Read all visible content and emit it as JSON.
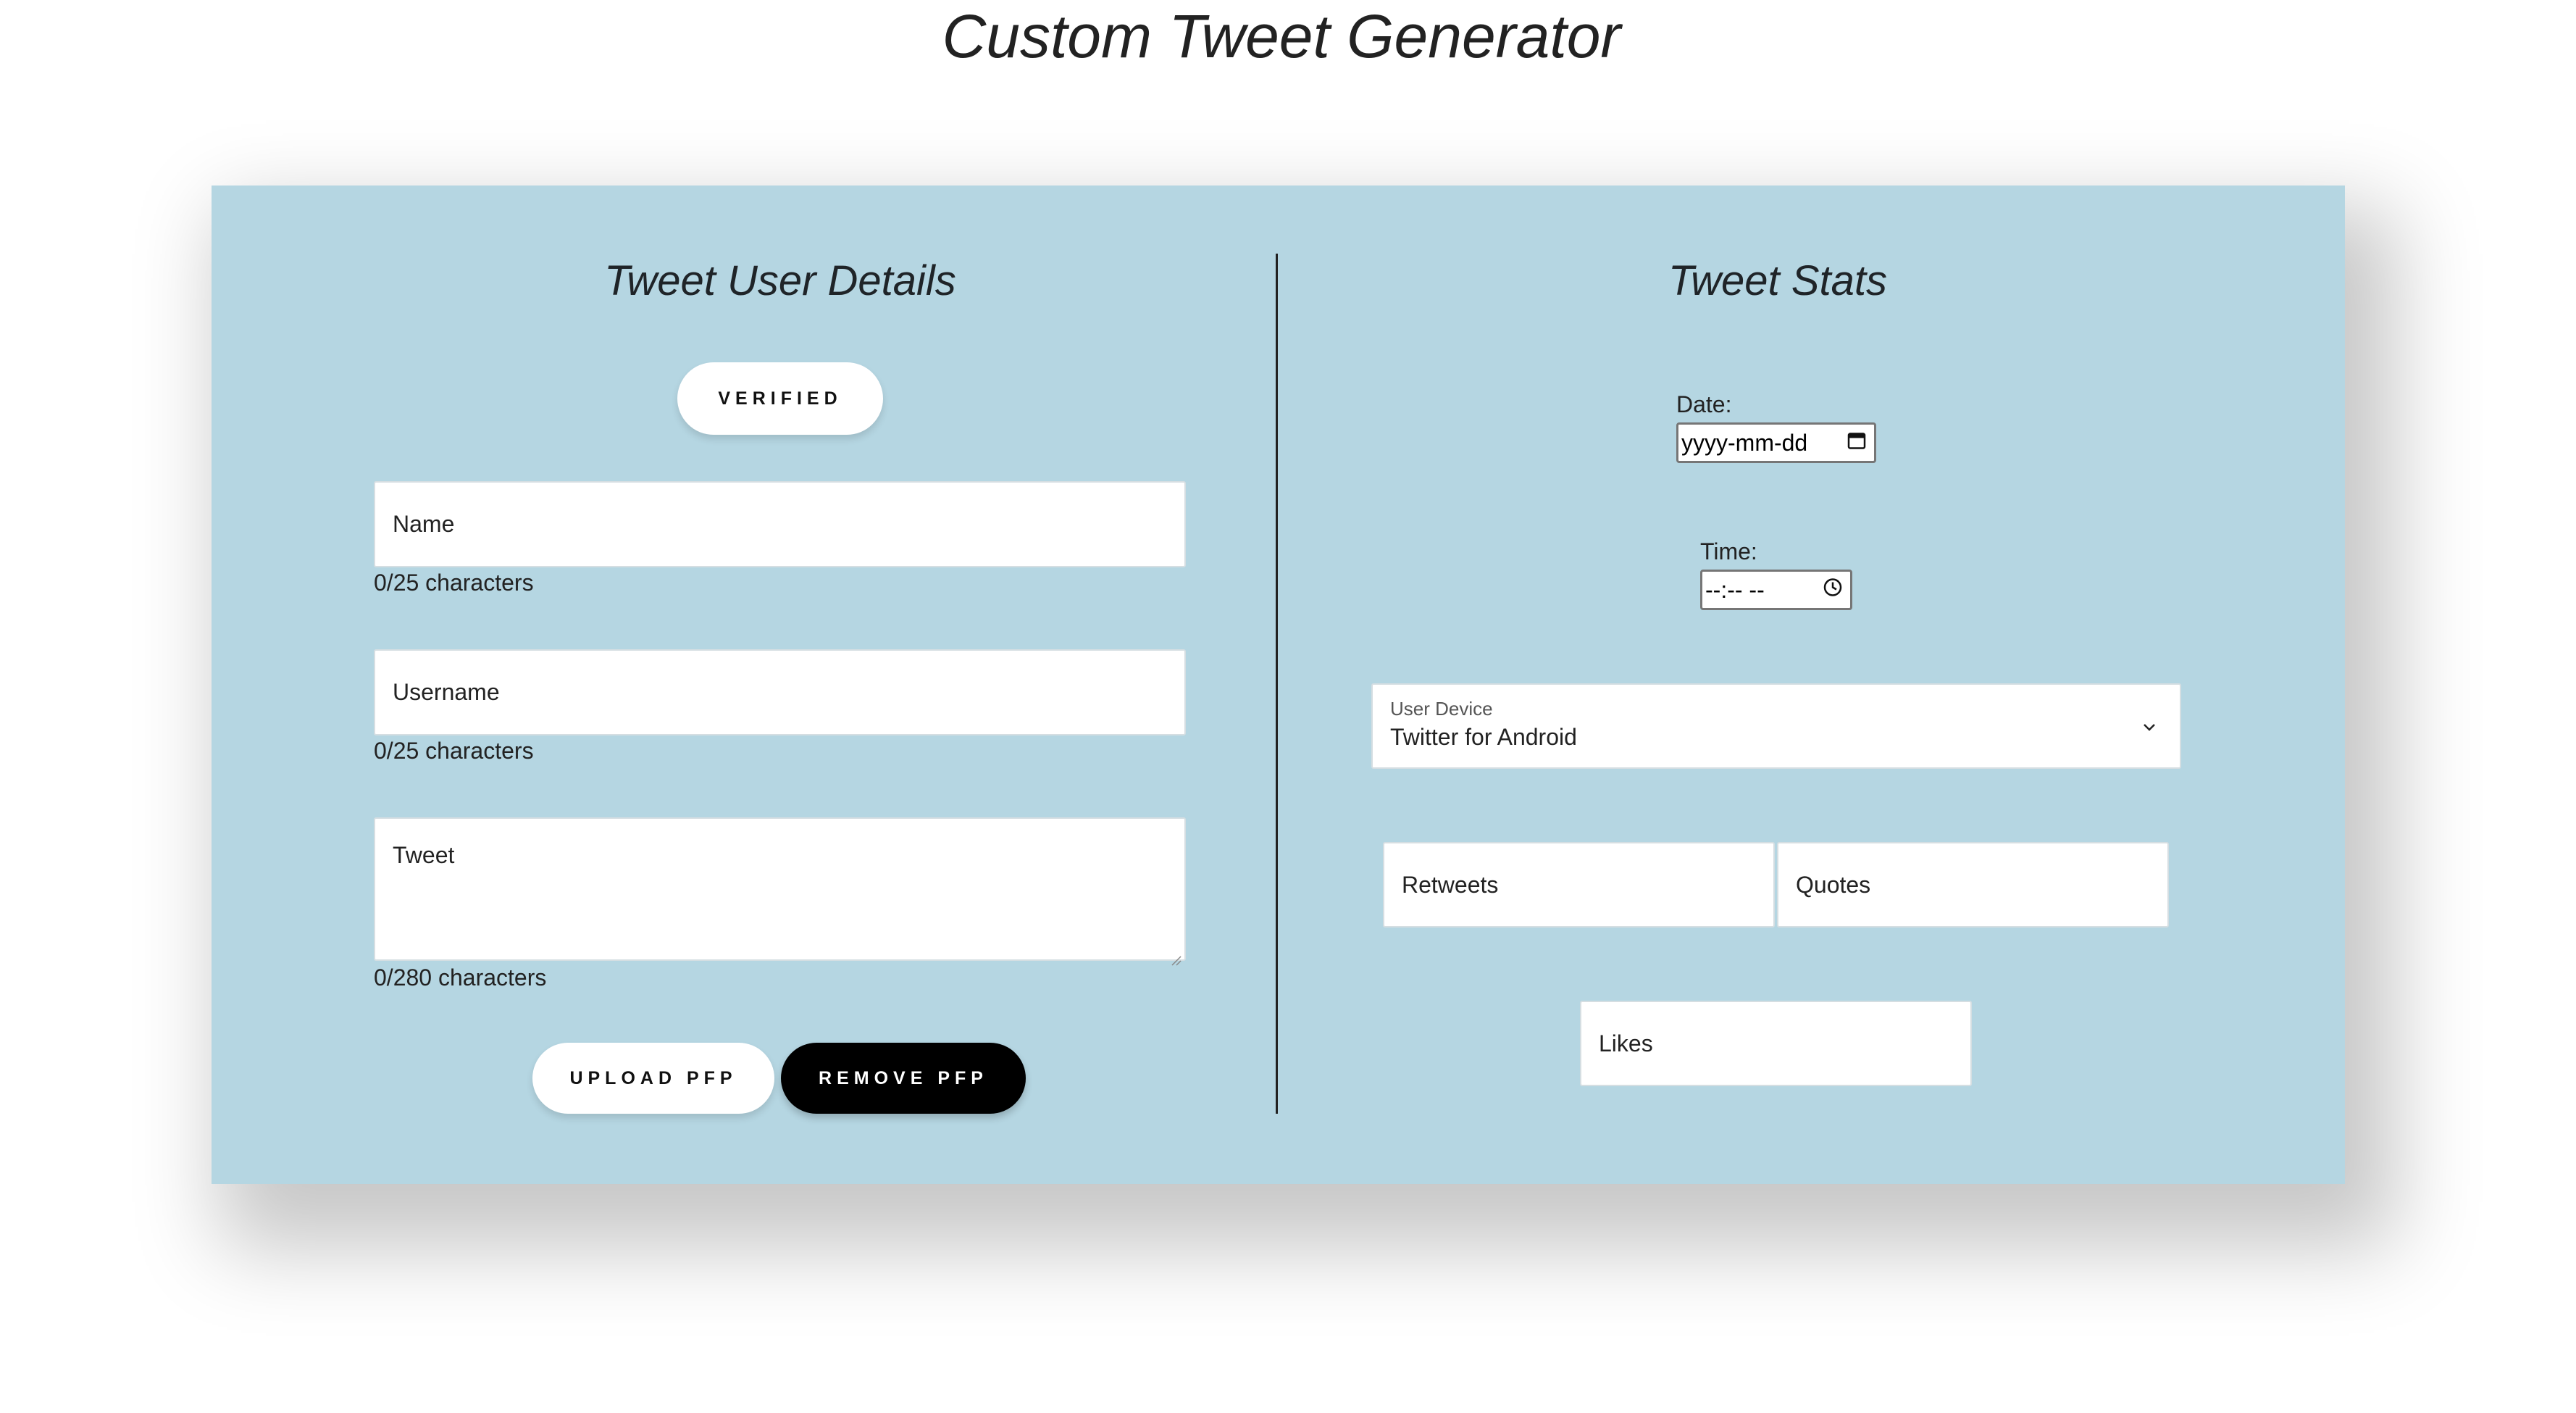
{
  "header": {
    "title": "Custom Tweet Generator"
  },
  "user_details": {
    "title": "Tweet User Details",
    "verified_label": "VERIFIED",
    "name": {
      "placeholder": "Name",
      "counter": "0/25 characters"
    },
    "username": {
      "placeholder": "Username",
      "counter": "0/25 characters"
    },
    "tweet": {
      "placeholder": "Tweet",
      "counter": "0/280 characters"
    },
    "upload_label": "UPLOAD PFP",
    "remove_label": "REMOVE PFP"
  },
  "stats": {
    "title": "Tweet Stats",
    "date_label": "Date:",
    "date_placeholder": "yyyy-mm-dd",
    "time_label": "Time:",
    "time_placeholder": "--:-- --",
    "device": {
      "label": "User Device",
      "value": "Twitter for Android"
    },
    "retweets_placeholder": "Retweets",
    "quotes_placeholder": "Quotes",
    "likes_placeholder": "Likes"
  },
  "colors": {
    "panel_background": "#b5d6e2",
    "page_background": "#ffffff",
    "button_dark": "#000000",
    "button_light": "#ffffff"
  },
  "icons": {
    "date": "calendar-icon",
    "time": "clock-icon",
    "select": "chevron-down-icon",
    "textarea": "resize-grip-icon"
  }
}
